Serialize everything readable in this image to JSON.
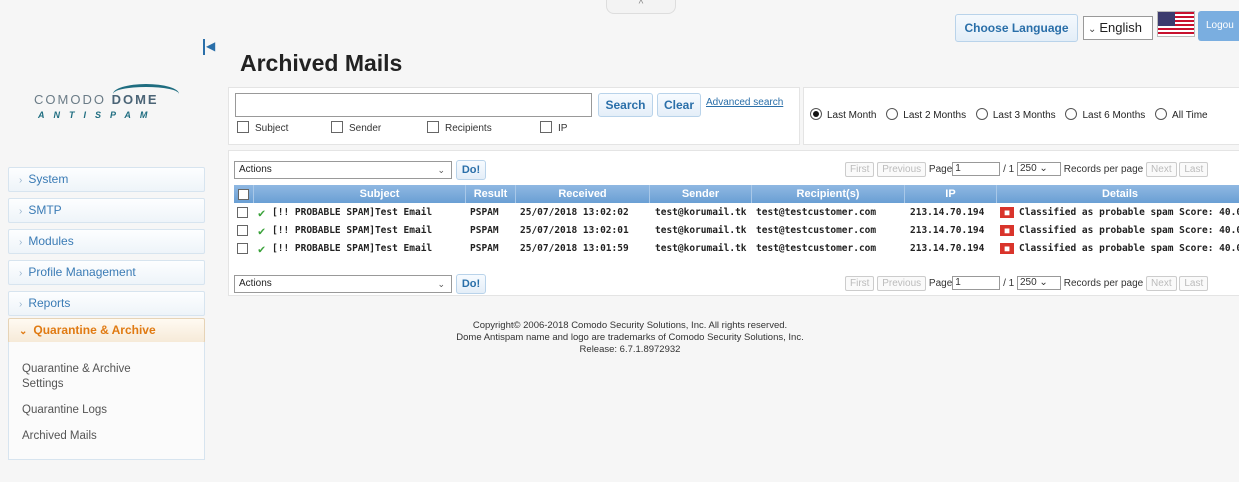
{
  "header": {
    "top_tab": "^",
    "choose_language": "Choose Language",
    "language": "English",
    "logout": "Logou"
  },
  "logo": {
    "word_a": "COMODO ",
    "word_b": "DOME",
    "sub": "ANTISPAM"
  },
  "sidebar": {
    "items": [
      {
        "label": "System"
      },
      {
        "label": "SMTP"
      },
      {
        "label": "Modules"
      },
      {
        "label": "Profile Management"
      },
      {
        "label": "Reports"
      },
      {
        "label": "Quarantine & Archive"
      }
    ],
    "subitems": [
      {
        "label": "Quarantine & Archive Settings"
      },
      {
        "label": "Quarantine Logs"
      },
      {
        "label": "Archived Mails"
      }
    ]
  },
  "main": {
    "title": "Archived Mails",
    "search": {
      "value": "",
      "search_label": "Search",
      "clear_label": "Clear",
      "advanced_label": "Advanced search",
      "filters": [
        "Subject",
        "Sender",
        "Recipients",
        "IP"
      ]
    },
    "time_ranges": [
      {
        "label": "Last Month",
        "selected": true
      },
      {
        "label": "Last 2 Months",
        "selected": false
      },
      {
        "label": "Last 3 Months",
        "selected": false
      },
      {
        "label": "Last 6 Months",
        "selected": false
      },
      {
        "label": "All Time",
        "selected": false
      }
    ],
    "actions_label": "Actions",
    "do_label": "Do!",
    "pager": {
      "first": "First",
      "previous": "Previous",
      "page_label": "Page",
      "page_value": "1",
      "of_label": "/ 1",
      "records": "250",
      "records_label": "Records per page",
      "next": "Next",
      "last": "Last"
    },
    "columns": [
      "Subject",
      "Result",
      "Received",
      "Sender",
      "Recipient(s)",
      "IP",
      "Details"
    ],
    "rows": [
      {
        "subject": "[!! PROBABLE SPAM]Test Email",
        "result": "PSPAM",
        "received": "25/07/2018 13:02:02",
        "sender": "test@korumail.tk",
        "recipient": "test@testcustomer.com",
        "ip": "213.14.70.194",
        "details": "Classified as probable spam Score: 40.0"
      },
      {
        "subject": "[!! PROBABLE SPAM]Test Email",
        "result": "PSPAM",
        "received": "25/07/2018 13:02:01",
        "sender": "test@korumail.tk",
        "recipient": "test@testcustomer.com",
        "ip": "213.14.70.194",
        "details": "Classified as probable spam Score: 40.0"
      },
      {
        "subject": "[!! PROBABLE SPAM]Test Email",
        "result": "PSPAM",
        "received": "25/07/2018 13:01:59",
        "sender": "test@korumail.tk",
        "recipient": "test@testcustomer.com",
        "ip": "213.14.70.194",
        "details": "Classified as probable spam Score: 40.0"
      }
    ]
  },
  "footer": {
    "line1": "Copyright© 2006-2018 Comodo Security Solutions, Inc. All rights reserved.",
    "line2": "Dome Antispam name and logo are trademarks of Comodo Security Solutions, Inc.",
    "line3": "Release: 6.7.1.8972932"
  }
}
